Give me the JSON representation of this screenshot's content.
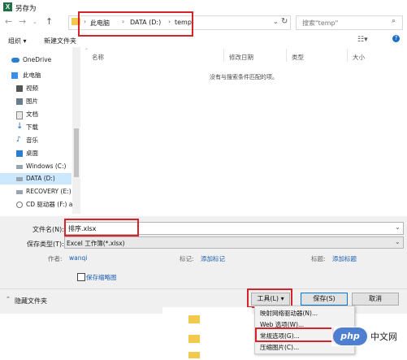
{
  "window": {
    "title": "另存为",
    "app_icon": "X"
  },
  "address": {
    "crumbs": [
      "此电脑",
      "DATA (D:)",
      "temp"
    ],
    "search_placeholder": "搜索\"temp\""
  },
  "toolbar": {
    "organize": "组织 ▾",
    "new_folder": "新建文件夹"
  },
  "nav": [
    {
      "label": "OneDrive",
      "icon": "cloud-icon"
    },
    {
      "label": "此电脑",
      "icon": "computer-icon"
    },
    {
      "label": "视频",
      "icon": "video-icon"
    },
    {
      "label": "图片",
      "icon": "pictures-icon"
    },
    {
      "label": "文档",
      "icon": "documents-icon"
    },
    {
      "label": "下载",
      "icon": "download-icon"
    },
    {
      "label": "音乐",
      "icon": "music-icon"
    },
    {
      "label": "桌面",
      "icon": "desktop-icon"
    },
    {
      "label": "Windows (C:)",
      "icon": "drive-icon"
    },
    {
      "label": "DATA (D:)",
      "icon": "drive-icon",
      "selected": true
    },
    {
      "label": "RECOVERY (E:)",
      "icon": "drive-icon"
    },
    {
      "label": "CD 驱动器 (F:) a",
      "icon": "cd-icon"
    }
  ],
  "list": {
    "columns": [
      "名称",
      "修改日期",
      "类型",
      "大小"
    ],
    "empty_message": "没有与搜索条件匹配的项。"
  },
  "save": {
    "filename_label": "文件名(N):",
    "filename": "排序.xlsx",
    "type_label": "保存类型(T):",
    "type": "Excel 工作簿(*.xlsx)",
    "author_key": "作者:",
    "author_val": "wanqi",
    "tags_key": "标记:",
    "tags_val": "添加标记",
    "title_key": "标题:",
    "title_val": "添加标题",
    "thumbnail_label": "保存缩略图"
  },
  "footer": {
    "hide_folders": "隐藏文件夹",
    "tools": "工具(L)",
    "save": "保存(S)",
    "cancel": "取消"
  },
  "tools_menu": [
    "映射网络驱动器(N)...",
    "Web 选项(W)...",
    "常规选项(G)...",
    "压缩图片(C)..."
  ],
  "watermark": {
    "logo": "php",
    "text": "中文网"
  },
  "colors": {
    "accent": "#0078d7",
    "highlight_red": "#d6242b",
    "selected": "#cce8ff",
    "link": "#1a5fb4"
  }
}
